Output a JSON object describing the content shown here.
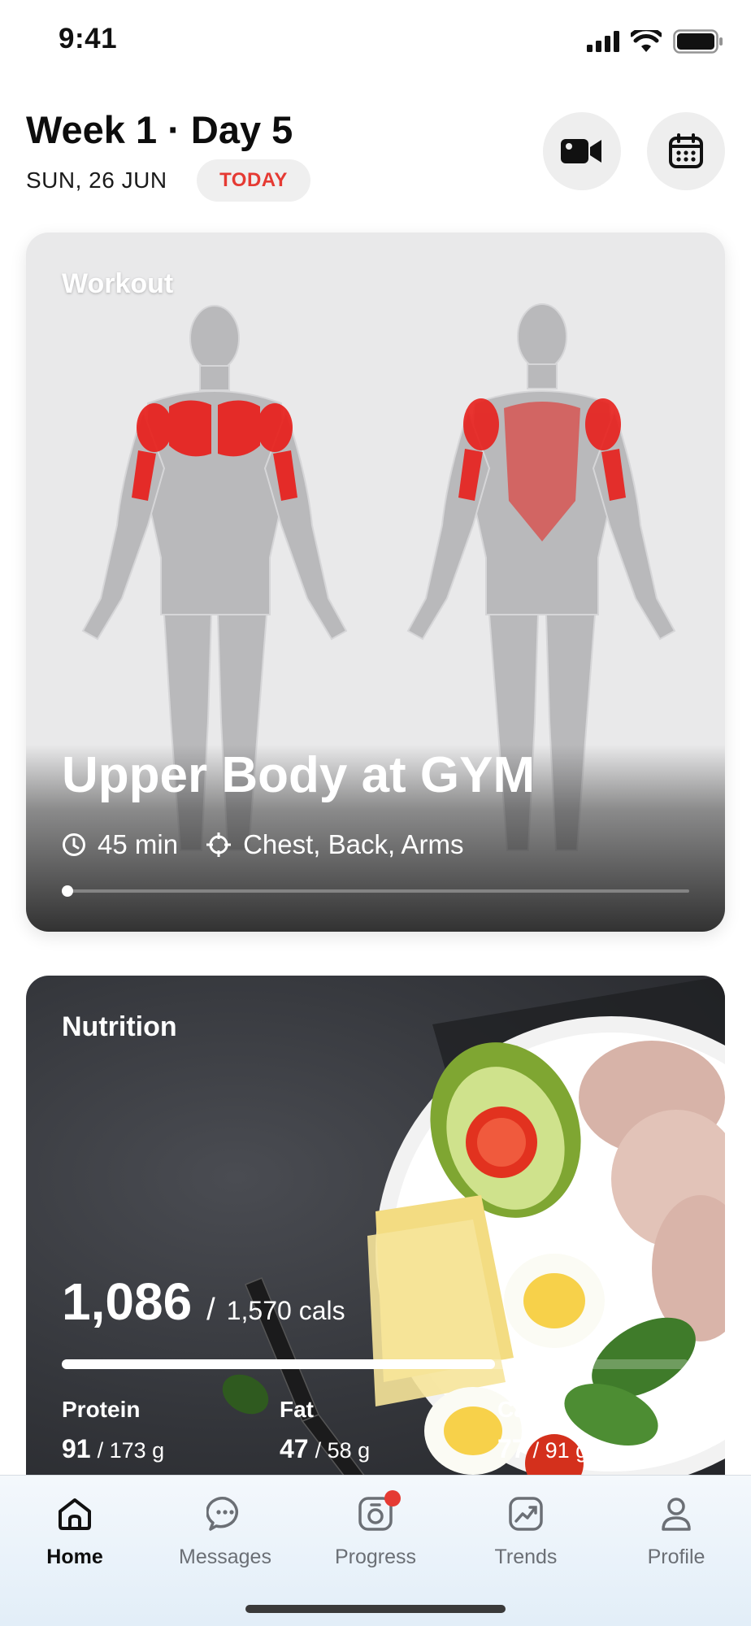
{
  "status_bar": {
    "time": "9:41"
  },
  "header": {
    "title": "Week 1 · Day 5",
    "date": "SUN, 26 JUN",
    "badge": "TODAY",
    "accent_color": "#e53a33"
  },
  "workout": {
    "label": "Workout",
    "title": "Upper Body at GYM",
    "duration": "45 min",
    "targets": "Chest, Back, Arms",
    "progress": 0,
    "highlight_color": "#e8201c"
  },
  "nutrition": {
    "label": "Nutrition",
    "calories_eaten": "1,086",
    "separator": "/",
    "calories_goal": "1,570 cals",
    "progress": 0.69,
    "macros": [
      {
        "name": "Protein",
        "value": "91",
        "goal": "/ 173 g"
      },
      {
        "name": "Fat",
        "value": "47",
        "goal": "/ 58 g"
      },
      {
        "name": "Carbs",
        "value": "77",
        "goal": "/ 91 g"
      }
    ]
  },
  "tab_bar": {
    "tabs": [
      {
        "label": "Home",
        "icon": "home-icon",
        "active": true
      },
      {
        "label": "Messages",
        "icon": "chat-icon",
        "active": false
      },
      {
        "label": "Progress",
        "icon": "camera-icon",
        "active": false,
        "badge": true
      },
      {
        "label": "Trends",
        "icon": "trend-chart-icon",
        "active": false
      },
      {
        "label": "Profile",
        "icon": "person-icon",
        "active": false
      }
    ]
  }
}
